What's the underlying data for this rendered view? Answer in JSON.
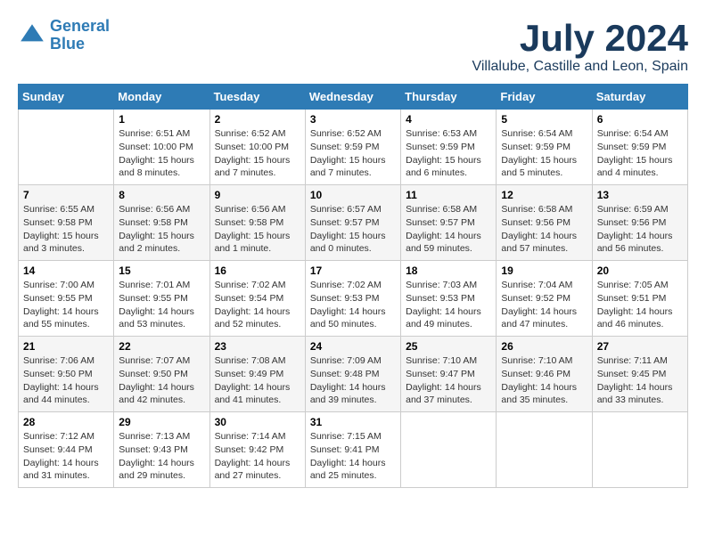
{
  "logo": {
    "line1": "General",
    "line2": "Blue"
  },
  "header": {
    "month": "July 2024",
    "location": "Villalube, Castille and Leon, Spain"
  },
  "days_of_week": [
    "Sunday",
    "Monday",
    "Tuesday",
    "Wednesday",
    "Thursday",
    "Friday",
    "Saturday"
  ],
  "weeks": [
    [
      {
        "day": "",
        "info": ""
      },
      {
        "day": "1",
        "info": "Sunrise: 6:51 AM\nSunset: 10:00 PM\nDaylight: 15 hours\nand 8 minutes."
      },
      {
        "day": "2",
        "info": "Sunrise: 6:52 AM\nSunset: 10:00 PM\nDaylight: 15 hours\nand 7 minutes."
      },
      {
        "day": "3",
        "info": "Sunrise: 6:52 AM\nSunset: 9:59 PM\nDaylight: 15 hours\nand 7 minutes."
      },
      {
        "day": "4",
        "info": "Sunrise: 6:53 AM\nSunset: 9:59 PM\nDaylight: 15 hours\nand 6 minutes."
      },
      {
        "day": "5",
        "info": "Sunrise: 6:54 AM\nSunset: 9:59 PM\nDaylight: 15 hours\nand 5 minutes."
      },
      {
        "day": "6",
        "info": "Sunrise: 6:54 AM\nSunset: 9:59 PM\nDaylight: 15 hours\nand 4 minutes."
      }
    ],
    [
      {
        "day": "7",
        "info": "Sunrise: 6:55 AM\nSunset: 9:58 PM\nDaylight: 15 hours\nand 3 minutes."
      },
      {
        "day": "8",
        "info": "Sunrise: 6:56 AM\nSunset: 9:58 PM\nDaylight: 15 hours\nand 2 minutes."
      },
      {
        "day": "9",
        "info": "Sunrise: 6:56 AM\nSunset: 9:58 PM\nDaylight: 15 hours\nand 1 minute."
      },
      {
        "day": "10",
        "info": "Sunrise: 6:57 AM\nSunset: 9:57 PM\nDaylight: 15 hours\nand 0 minutes."
      },
      {
        "day": "11",
        "info": "Sunrise: 6:58 AM\nSunset: 9:57 PM\nDaylight: 14 hours\nand 59 minutes."
      },
      {
        "day": "12",
        "info": "Sunrise: 6:58 AM\nSunset: 9:56 PM\nDaylight: 14 hours\nand 57 minutes."
      },
      {
        "day": "13",
        "info": "Sunrise: 6:59 AM\nSunset: 9:56 PM\nDaylight: 14 hours\nand 56 minutes."
      }
    ],
    [
      {
        "day": "14",
        "info": "Sunrise: 7:00 AM\nSunset: 9:55 PM\nDaylight: 14 hours\nand 55 minutes."
      },
      {
        "day": "15",
        "info": "Sunrise: 7:01 AM\nSunset: 9:55 PM\nDaylight: 14 hours\nand 53 minutes."
      },
      {
        "day": "16",
        "info": "Sunrise: 7:02 AM\nSunset: 9:54 PM\nDaylight: 14 hours\nand 52 minutes."
      },
      {
        "day": "17",
        "info": "Sunrise: 7:02 AM\nSunset: 9:53 PM\nDaylight: 14 hours\nand 50 minutes."
      },
      {
        "day": "18",
        "info": "Sunrise: 7:03 AM\nSunset: 9:53 PM\nDaylight: 14 hours\nand 49 minutes."
      },
      {
        "day": "19",
        "info": "Sunrise: 7:04 AM\nSunset: 9:52 PM\nDaylight: 14 hours\nand 47 minutes."
      },
      {
        "day": "20",
        "info": "Sunrise: 7:05 AM\nSunset: 9:51 PM\nDaylight: 14 hours\nand 46 minutes."
      }
    ],
    [
      {
        "day": "21",
        "info": "Sunrise: 7:06 AM\nSunset: 9:50 PM\nDaylight: 14 hours\nand 44 minutes."
      },
      {
        "day": "22",
        "info": "Sunrise: 7:07 AM\nSunset: 9:50 PM\nDaylight: 14 hours\nand 42 minutes."
      },
      {
        "day": "23",
        "info": "Sunrise: 7:08 AM\nSunset: 9:49 PM\nDaylight: 14 hours\nand 41 minutes."
      },
      {
        "day": "24",
        "info": "Sunrise: 7:09 AM\nSunset: 9:48 PM\nDaylight: 14 hours\nand 39 minutes."
      },
      {
        "day": "25",
        "info": "Sunrise: 7:10 AM\nSunset: 9:47 PM\nDaylight: 14 hours\nand 37 minutes."
      },
      {
        "day": "26",
        "info": "Sunrise: 7:10 AM\nSunset: 9:46 PM\nDaylight: 14 hours\nand 35 minutes."
      },
      {
        "day": "27",
        "info": "Sunrise: 7:11 AM\nSunset: 9:45 PM\nDaylight: 14 hours\nand 33 minutes."
      }
    ],
    [
      {
        "day": "28",
        "info": "Sunrise: 7:12 AM\nSunset: 9:44 PM\nDaylight: 14 hours\nand 31 minutes."
      },
      {
        "day": "29",
        "info": "Sunrise: 7:13 AM\nSunset: 9:43 PM\nDaylight: 14 hours\nand 29 minutes."
      },
      {
        "day": "30",
        "info": "Sunrise: 7:14 AM\nSunset: 9:42 PM\nDaylight: 14 hours\nand 27 minutes."
      },
      {
        "day": "31",
        "info": "Sunrise: 7:15 AM\nSunset: 9:41 PM\nDaylight: 14 hours\nand 25 minutes."
      },
      {
        "day": "",
        "info": ""
      },
      {
        "day": "",
        "info": ""
      },
      {
        "day": "",
        "info": ""
      }
    ]
  ]
}
